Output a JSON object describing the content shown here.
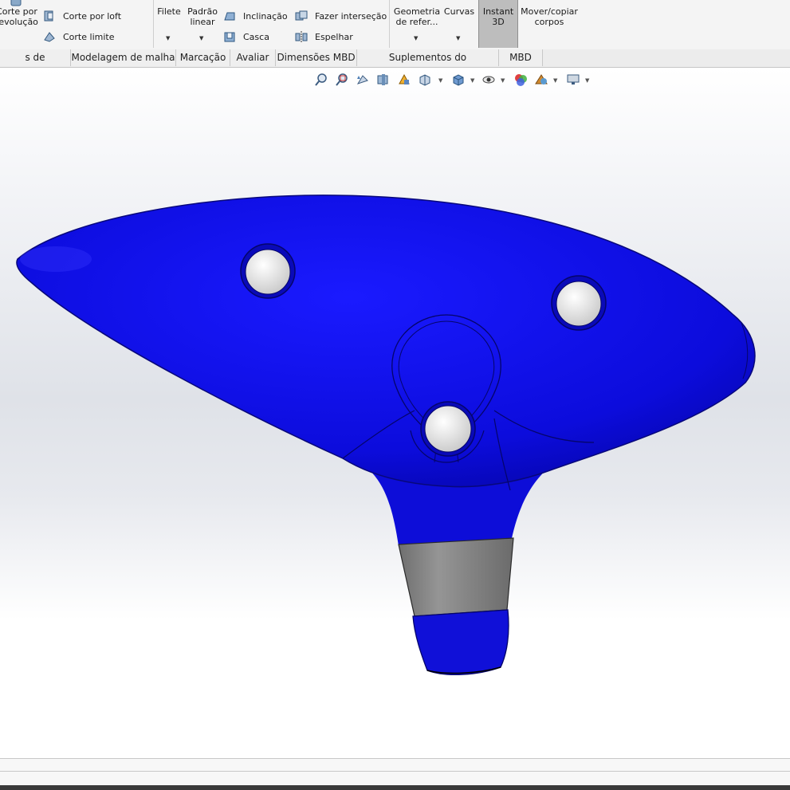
{
  "ribbon": {
    "corte_revolucao": "Corte por revolução",
    "corte_loft": "Corte por loft",
    "corte_limite": "Corte limite",
    "filete": "Filete",
    "padrao_linear": "Padrão linear",
    "inclinacao": "Inclinação",
    "casca": "Casca",
    "fazer_intersecao": "Fazer interseção",
    "espelhar": "Espelhar",
    "geometria_ref": "Geometria de refer...",
    "curvas": "Curvas",
    "instant3d": "Instant 3D",
    "mover_copiar": "Mover/copiar corpos"
  },
  "tabs": [
    "s de moldagem",
    "Modelagem de malha",
    "Marcação",
    "Avaliar",
    "Dimensões MBD",
    "Suplementos do SOLIDWORKS",
    "MBD"
  ],
  "colors": {
    "model_blue": "#1010d8",
    "mouthpiece_gray": "#8a8a8a"
  }
}
